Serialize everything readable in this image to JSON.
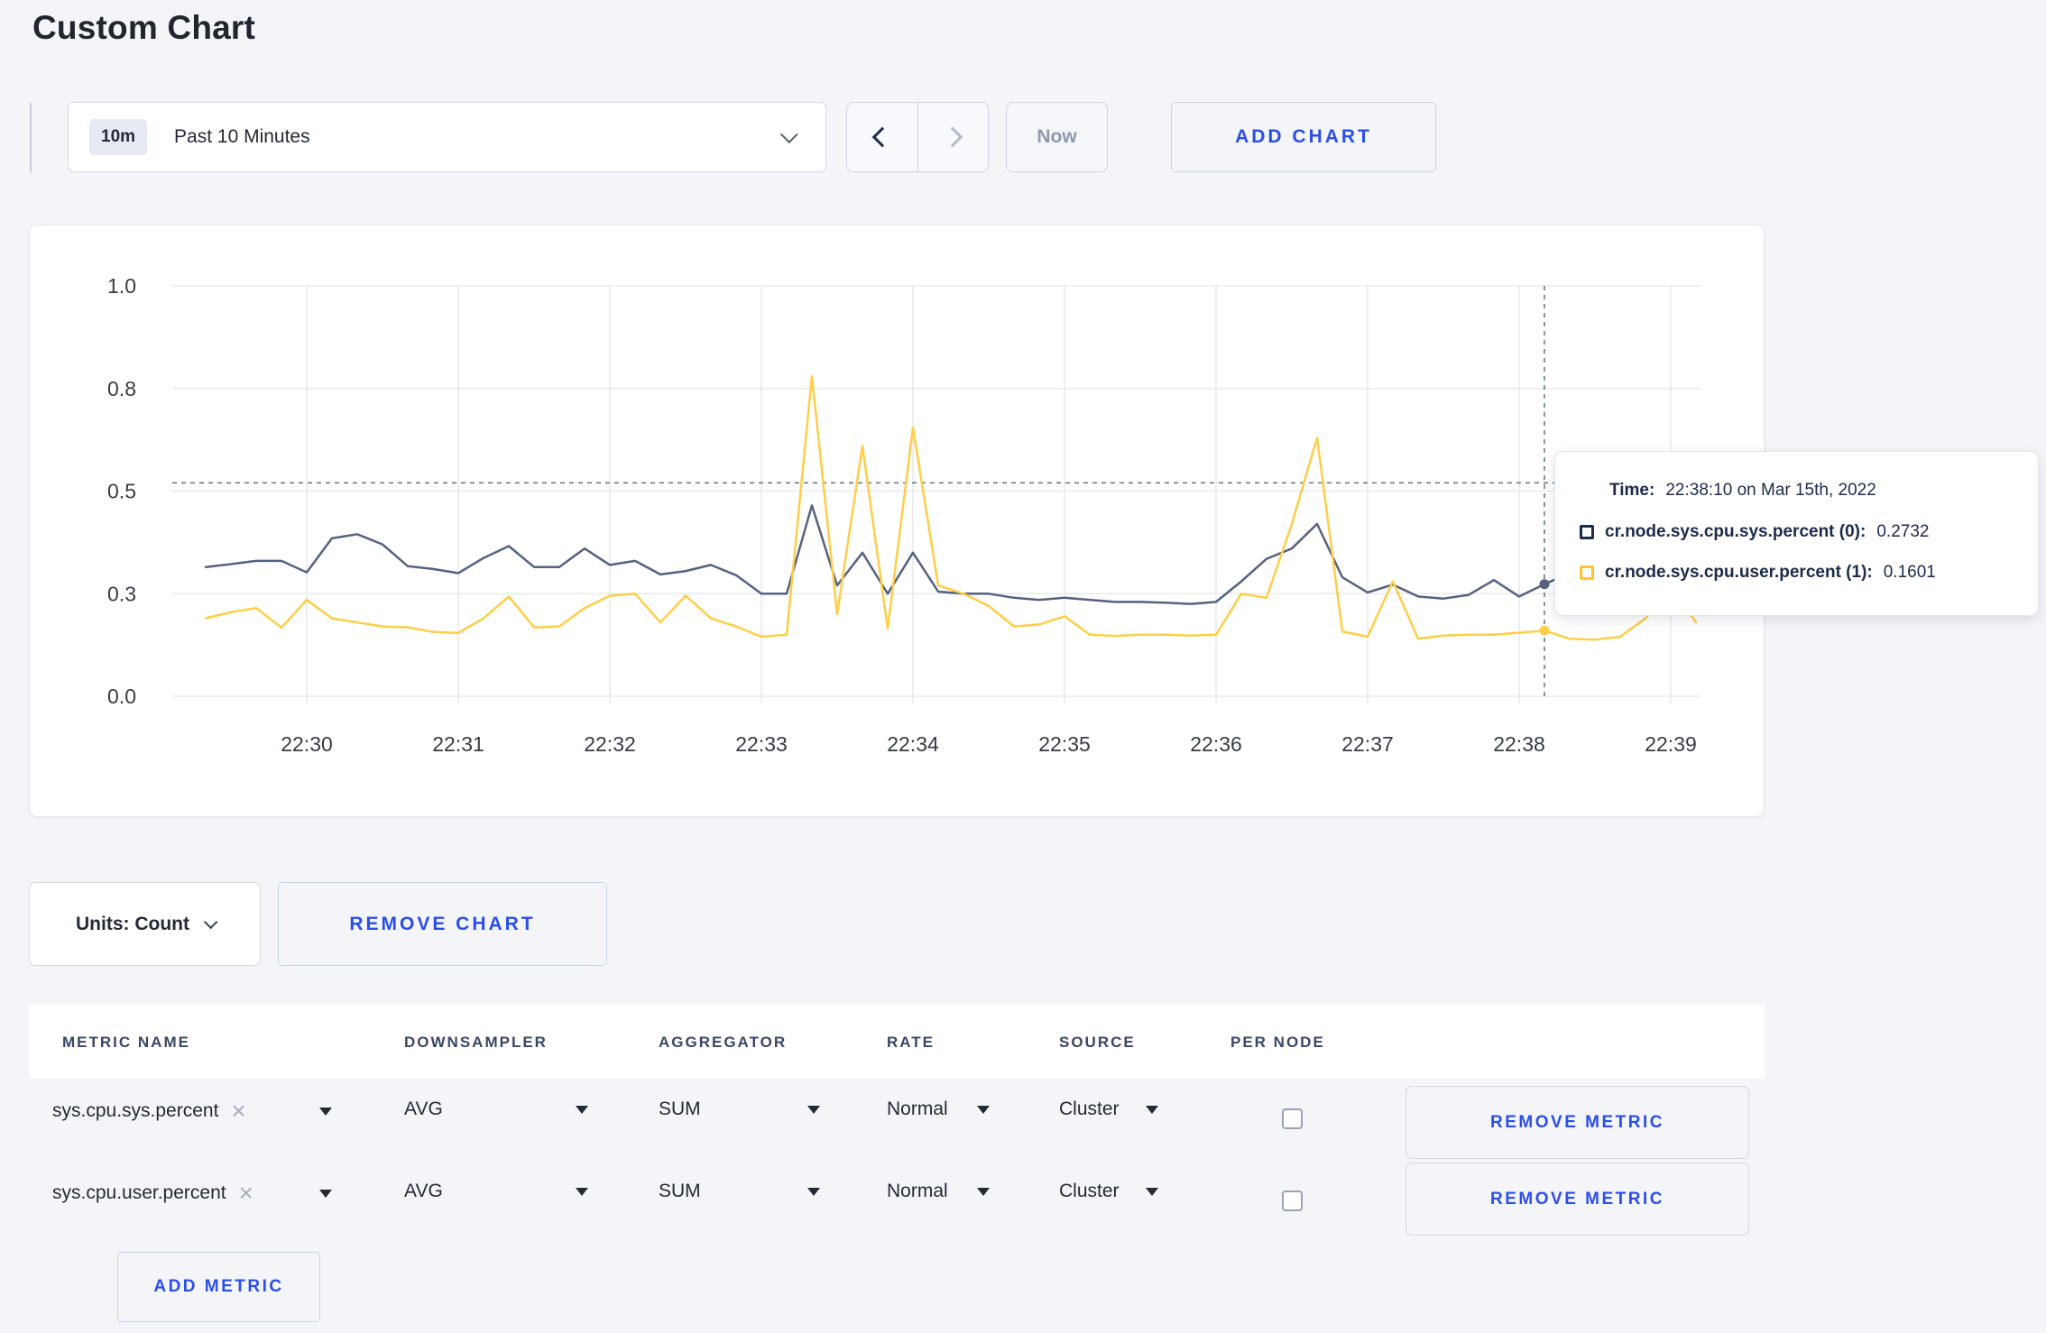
{
  "page": {
    "title": "Custom Chart"
  },
  "toolbar": {
    "range_badge": "10m",
    "range_label": "Past 10 Minutes",
    "prev_icon": "chevron-left",
    "next_icon": "chevron-right",
    "now_label": "Now",
    "add_chart_label": "ADD CHART"
  },
  "colors": {
    "accent_blue": "#2b4eeb",
    "series_sys": "#55627e",
    "series_user": "#ffce47",
    "crosshair": "#5e7186",
    "gridline": "#e8eaee",
    "page_bg": "#f4f5f9"
  },
  "chart_data": {
    "type": "line",
    "title": "",
    "xlabel": "",
    "ylabel": "",
    "ylim": [
      0,
      1
    ],
    "grid": true,
    "x_step_seconds": 10,
    "x_first_point": "22:29:20",
    "x_ticks": [
      "22:30",
      "22:31",
      "22:32",
      "22:33",
      "22:34",
      "22:35",
      "22:36",
      "22:37",
      "22:38",
      "22:39"
    ],
    "x_tick_first_point_index": 4,
    "points_per_tick": 6,
    "y_ticks": [
      {
        "value": 1.0,
        "label": "1.0"
      },
      {
        "value": 0.75,
        "label": "0.8"
      },
      {
        "value": 0.5,
        "label": "0.5"
      },
      {
        "value": 0.25,
        "label": "0.3"
      },
      {
        "value": 0.0,
        "label": "0.0"
      }
    ],
    "series": [
      {
        "name": "cr.node.sys.cpu.sys.percent",
        "color": "#55627e",
        "values": [
          0.315,
          0.322,
          0.33,
          0.33,
          0.302,
          0.385,
          0.395,
          0.37,
          0.317,
          0.31,
          0.3,
          0.337,
          0.366,
          0.315,
          0.315,
          0.36,
          0.32,
          0.33,
          0.297,
          0.305,
          0.32,
          0.295,
          0.25,
          0.25,
          0.465,
          0.27,
          0.35,
          0.25,
          0.35,
          0.255,
          0.25,
          0.25,
          0.24,
          0.235,
          0.24,
          0.235,
          0.23,
          0.23,
          0.228,
          0.225,
          0.23,
          0.28,
          0.335,
          0.36,
          0.42,
          0.29,
          0.253,
          0.272,
          0.243,
          0.238,
          0.247,
          0.283,
          0.243,
          0.2732,
          0.3,
          0.29,
          0.3,
          0.3,
          0.31,
          0.3
        ]
      },
      {
        "name": "cr.node.sys.cpu.user.percent",
        "color": "#ffce47",
        "values": [
          0.19,
          0.205,
          0.215,
          0.167,
          0.235,
          0.19,
          0.18,
          0.17,
          0.168,
          0.157,
          0.154,
          0.19,
          0.243,
          0.168,
          0.17,
          0.215,
          0.245,
          0.25,
          0.18,
          0.245,
          0.19,
          0.17,
          0.145,
          0.15,
          0.78,
          0.2,
          0.61,
          0.165,
          0.655,
          0.27,
          0.25,
          0.22,
          0.17,
          0.175,
          0.195,
          0.15,
          0.147,
          0.15,
          0.15,
          0.148,
          0.15,
          0.25,
          0.24,
          0.42,
          0.63,
          0.158,
          0.145,
          0.28,
          0.14,
          0.148,
          0.15,
          0.15,
          0.155,
          0.1601,
          0.14,
          0.138,
          0.145,
          0.19,
          0.27,
          0.18
        ]
      }
    ],
    "crosshair": {
      "point_index": 53,
      "hover_value": 0.52,
      "time": "22:38:10"
    },
    "legend_position": "tooltip"
  },
  "tooltip": {
    "time_label": "Time:",
    "time_value": "22:38:10 on Mar 15th, 2022",
    "rows": [
      {
        "name": "cr.node.sys.cpu.sys.percent (0):",
        "value": "0.2732",
        "swatch_color": "#1b2d4f"
      },
      {
        "name": "cr.node.sys.cpu.user.percent (1):",
        "value": "0.1601",
        "swatch_color": "#ffc62c"
      }
    ]
  },
  "chart_footer": {
    "units_label": "Units: Count",
    "remove_chart_label": "REMOVE CHART"
  },
  "metrics_table": {
    "columns": [
      "METRIC NAME",
      "DOWNSAMPLER",
      "AGGREGATOR",
      "RATE",
      "SOURCE",
      "PER NODE"
    ],
    "rows": [
      {
        "metric": "sys.cpu.sys.percent",
        "downsampler": "AVG",
        "aggregator": "SUM",
        "rate": "Normal",
        "source": "Cluster",
        "per_node_checked": false,
        "remove_label": "REMOVE METRIC"
      },
      {
        "metric": "sys.cpu.user.percent",
        "downsampler": "AVG",
        "aggregator": "SUM",
        "rate": "Normal",
        "source": "Cluster",
        "per_node_checked": false,
        "remove_label": "REMOVE METRIC"
      }
    ],
    "add_metric_label": "ADD METRIC",
    "close_icon": "×"
  }
}
